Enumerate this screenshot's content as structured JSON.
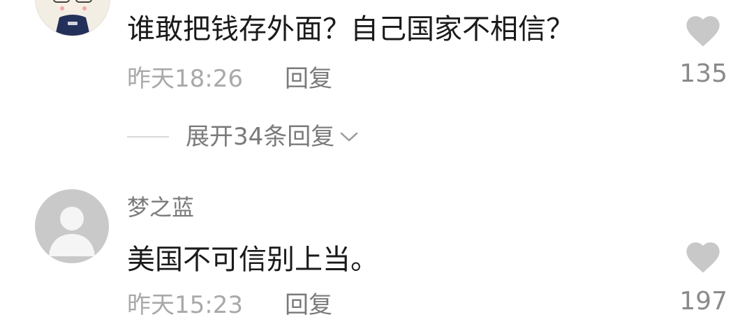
{
  "comments": [
    {
      "text": "谁敢把钱存外面？自己国家不相信？",
      "time": "昨天18:26",
      "reply_label": "回复",
      "likes": "135",
      "avatar_icon": "cartoon-avatar-icon",
      "expand_label": "展开34条回复"
    },
    {
      "username": "梦之蓝",
      "text": "美国不可信别上当。",
      "time": "昨天15:23",
      "reply_label": "回复",
      "likes": "197",
      "avatar_icon": "default-user-icon"
    }
  ],
  "colors": {
    "text": "#1a1a1a",
    "meta": "#a9a9a9",
    "secondary": "#7a7a7a",
    "heart": "#c8c8c8",
    "avatar_default": "#c9c9c9"
  }
}
